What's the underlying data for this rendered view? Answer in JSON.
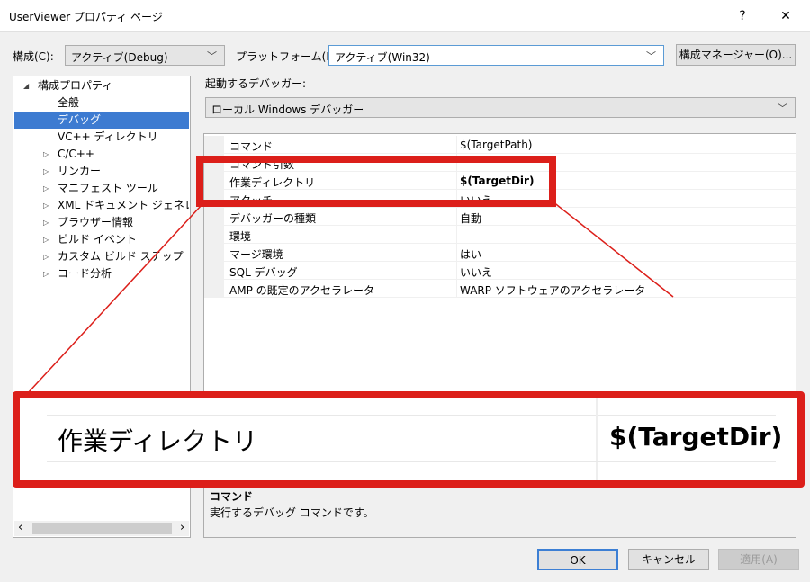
{
  "window": {
    "title": "UserViewer プロパティ ページ",
    "help": "?",
    "close": "✕"
  },
  "toolbar": {
    "config_label": "構成(C):",
    "config_value": "アクティブ(Debug)",
    "platform_label": "プラットフォーム(P):",
    "platform_value": "アクティブ(Win32)",
    "config_manager": "構成マネージャー(O)..."
  },
  "tree": {
    "items": [
      {
        "label": "構成プロパティ",
        "arrow": "◢"
      },
      {
        "label": "全般"
      },
      {
        "label": "デバッグ"
      },
      {
        "label": "VC++ ディレクトリ"
      },
      {
        "label": "C/C++",
        "arrow": "▷"
      },
      {
        "label": "リンカー",
        "arrow": "▷"
      },
      {
        "label": "マニフェスト ツール",
        "arrow": "▷"
      },
      {
        "label": "XML ドキュメント ジェネレーター",
        "arrow": "▷"
      },
      {
        "label": "ブラウザー情報",
        "arrow": "▷"
      },
      {
        "label": "ビルド イベント",
        "arrow": "▷"
      },
      {
        "label": "カスタム ビルド ステップ",
        "arrow": "▷"
      },
      {
        "label": "コード分析",
        "arrow": "▷"
      }
    ],
    "scroll_left": "‹",
    "scroll_right": "›"
  },
  "debugger": {
    "label": "起動するデバッガー:",
    "value": "ローカル Windows デバッガー"
  },
  "grid": {
    "rows": [
      {
        "name": "コマンド",
        "value": "$(TargetPath)"
      },
      {
        "name": "コマンド引数",
        "value": ""
      },
      {
        "name": "作業ディレクトリ",
        "value": "$(TargetDir)"
      },
      {
        "name": "アタッチ",
        "value": "いいえ"
      },
      {
        "name": "デバッガーの種類",
        "value": "自動"
      },
      {
        "name": "環境",
        "value": ""
      },
      {
        "name": "マージ環境",
        "value": "はい"
      },
      {
        "name": "SQL デバッグ",
        "value": "いいえ"
      },
      {
        "name": "AMP の既定のアクセラレータ",
        "value": "WARP ソフトウェアのアクセラレータ"
      }
    ]
  },
  "description": {
    "title": "コマンド",
    "text": "実行するデバッグ コマンドです。"
  },
  "buttons": {
    "ok": "OK",
    "cancel": "キャンセル",
    "apply": "適用(A)"
  },
  "callout": {
    "name": "作業ディレクトリ",
    "value": "$(TargetDir)",
    "color": "#dc1f1a"
  }
}
